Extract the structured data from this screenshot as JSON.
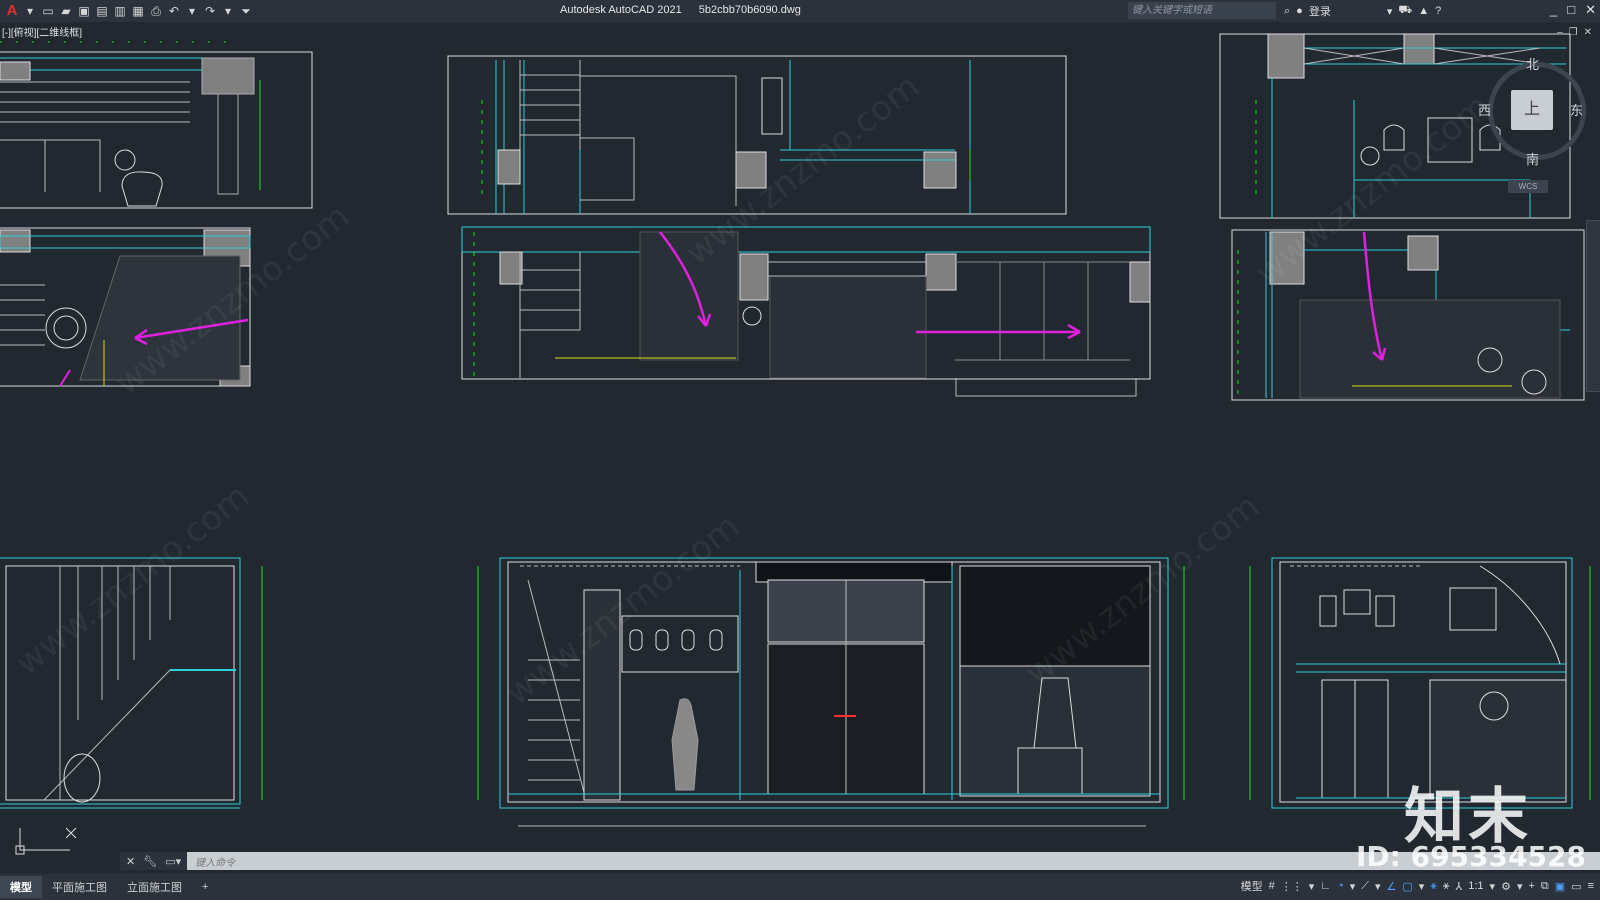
{
  "app": {
    "title": "Autodesk AutoCAD 2021",
    "filename": "5b2cbb70b6090.dwg",
    "logo": "A",
    "quick_access_icons": [
      "new-icon",
      "open-icon",
      "save-icon",
      "save-as-icon",
      "publish-icon",
      "plot-preview-icon",
      "print-icon",
      "undo-icon",
      "redo-icon",
      "customize-icon"
    ],
    "search_placeholder": "键入关键字或短语",
    "login_label": "登录",
    "window_controls": [
      "_",
      "□",
      "✕"
    ]
  },
  "viewport": {
    "label": "[-][俯视][二维线框]",
    "viewcube": {
      "north": "北",
      "south": "南",
      "west": "西",
      "east": "东",
      "top": "上",
      "wcs": "WCS"
    }
  },
  "command": {
    "placeholder": "键入命令",
    "icons": [
      "close-icon",
      "wrench-icon",
      "command-history-icon"
    ]
  },
  "layout_tabs": [
    {
      "label": "模型",
      "active": true
    },
    {
      "label": "平面施工图",
      "active": false
    },
    {
      "label": "立面施工图",
      "active": false
    }
  ],
  "add_tab": "+",
  "status": {
    "model_label": "模型",
    "scale_label": "1:1"
  },
  "watermark": {
    "id_text": "ID: 695334528",
    "logo_text": "知末",
    "site_text": "www.znzmo.com"
  },
  "colors": {
    "background": "#212830",
    "cyan": "#2bd0d8",
    "green": "#19e619",
    "magenta": "#e020e0",
    "yellow": "#d8d820",
    "wall_fill": "#808080"
  }
}
